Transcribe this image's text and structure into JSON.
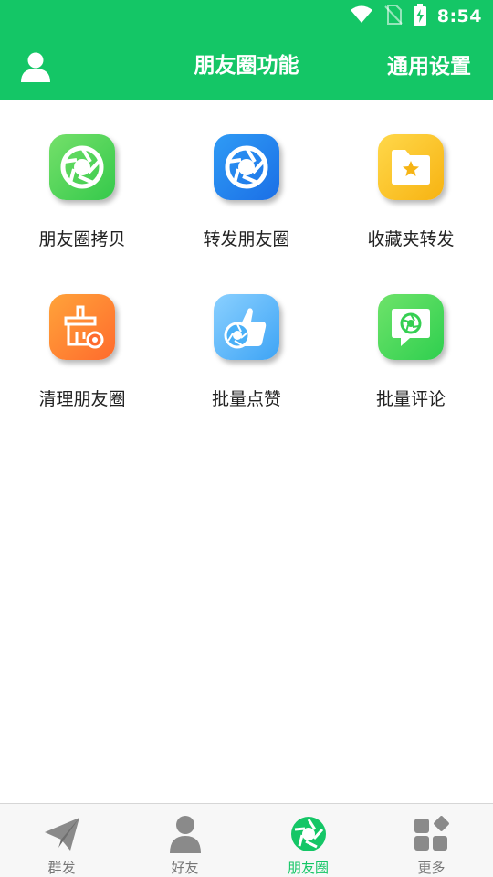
{
  "status_bar": {
    "time": "8:54",
    "icons": [
      "wifi-icon",
      "no-sim-icon",
      "battery-charging-icon"
    ]
  },
  "header": {
    "title": "朋友圈功能",
    "settings_label": "通用设置",
    "left_icon": "user-icon"
  },
  "grid": {
    "items": [
      {
        "label": "朋友圈拷贝",
        "icon": "camera-aperture-icon",
        "color": "#4fd457"
      },
      {
        "label": "转发朋友圈",
        "icon": "camera-aperture-icon",
        "color": "#2385ee"
      },
      {
        "label": "收藏夹转发",
        "icon": "star-folder-icon",
        "color": "#fcc42c"
      },
      {
        "label": "清理朋友圈",
        "icon": "broom-icon",
        "color": "#ff8533"
      },
      {
        "label": "批量点赞",
        "icon": "thumbs-up-icon",
        "color": "#5ab7f8"
      },
      {
        "label": "批量评论",
        "icon": "comment-bubble-icon",
        "color": "#47d95c"
      }
    ]
  },
  "bottom_nav": {
    "active_color": "#14c666",
    "items": [
      {
        "label": "群发",
        "icon": "paper-plane-icon",
        "active": false
      },
      {
        "label": "好友",
        "icon": "person-icon",
        "active": false
      },
      {
        "label": "朋友圈",
        "icon": "camera-aperture-icon",
        "active": true
      },
      {
        "label": "更多",
        "icon": "apps-grid-icon",
        "active": false
      }
    ]
  },
  "colors": {
    "brand": "#14c666",
    "background": "#ffffff",
    "label_text": "#222222",
    "nav_inactive": "#777777"
  }
}
